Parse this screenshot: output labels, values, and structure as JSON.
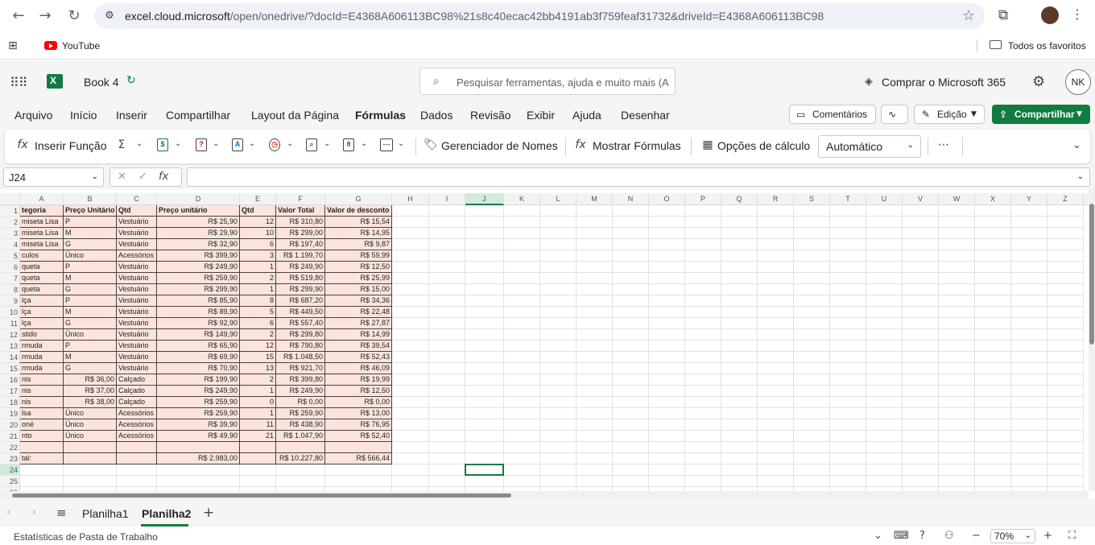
{
  "browser": {
    "url_host": "excel.cloud.microsoft",
    "url_rest": "/open/onedrive/?docId=E4368A606113BC98%21s8c40ecac42bb4191ab3f759feaf31732&driveId=E4368A606113BC98",
    "bookmark_youtube": "YouTube",
    "bookmarks_all": "Todos os favoritos"
  },
  "header": {
    "book_title": "Book 4",
    "search_placeholder": "Pesquisar ferramentas, ajuda e muito mais (A",
    "buy_label": "Comprar o Microsoft 365",
    "avatar_initials": "NK"
  },
  "menu": {
    "tabs": [
      "Arquivo",
      "Início",
      "Inserir",
      "Compartilhar",
      "Layout da Página",
      "Fórmulas",
      "Dados",
      "Revisão",
      "Exibir",
      "Ajuda",
      "Desenhar"
    ],
    "active": "Fórmulas",
    "comments": "Comentários",
    "editing": "Edição",
    "share": "Compartilhar"
  },
  "ribbon": {
    "insert_function": "Inserir Função",
    "name_manager": "Gerenciador de Nomes",
    "show_formulas": "Mostrar Fórmulas",
    "calc_options": "Opções de cálculo",
    "calc_mode": "Automático"
  },
  "formula_bar": {
    "name_box": "J24",
    "fx": "fx"
  },
  "grid": {
    "selected_column": "J",
    "selected_row": "24",
    "columns": [
      "A",
      "B",
      "C",
      "D",
      "E",
      "F",
      "G",
      "H",
      "I",
      "J",
      "K",
      "L",
      "M",
      "N",
      "O",
      "P",
      "Q",
      "R",
      "S",
      "T",
      "U",
      "V",
      "W",
      "X",
      "Y",
      "Z"
    ],
    "row_numbers": [
      "1",
      "2",
      "3",
      "4",
      "5",
      "6",
      "7",
      "8",
      "9",
      "10",
      "11",
      "12",
      "13",
      "14",
      "15",
      "16",
      "17",
      "18",
      "19",
      "20",
      "21",
      "22",
      "23",
      "24",
      "25",
      "26"
    ],
    "table_header": [
      "tegoria",
      "Preço Unitário",
      "Qtd",
      "Preço unitário",
      "Qtd",
      "Valor Total",
      "Valor de desconto"
    ],
    "table_rows": [
      [
        "miseta Lisa",
        "P",
        "Vestuário",
        "R$ 25,90",
        "12",
        "R$ 310,80",
        "R$ 15,54"
      ],
      [
        "miseta Lisa",
        "M",
        "Vestuário",
        "R$ 29,90",
        "10",
        "R$ 299,00",
        "R$ 14,95"
      ],
      [
        "miseta Lisa",
        "G",
        "Vestuário",
        "R$ 32,90",
        "6",
        "R$ 197,40",
        "R$ 9,87"
      ],
      [
        "culos",
        "Único",
        "Acessórios",
        "R$ 399,90",
        "3",
        "R$ 1.199,70",
        "R$ 59,99"
      ],
      [
        "queta",
        "P",
        "Vestuário",
        "R$ 249,90",
        "1",
        "R$ 249,90",
        "R$ 12,50"
      ],
      [
        "queta",
        "M",
        "Vestuário",
        "R$ 259,90",
        "2",
        "R$ 519,80",
        "R$ 25,99"
      ],
      [
        "queta",
        "G",
        "Vestuário",
        "R$ 299,90",
        "1",
        "R$ 299,90",
        "R$ 15,00"
      ],
      [
        "lça",
        "P",
        "Vestuário",
        "R$ 85,90",
        "8",
        "R$ 687,20",
        "R$ 34,36"
      ],
      [
        "lça",
        "M",
        "Vestuário",
        "R$ 89,90",
        "5",
        "R$ 449,50",
        "R$ 22,48"
      ],
      [
        "lça",
        "G",
        "Vestuário",
        "R$ 92,90",
        "6",
        "R$ 557,40",
        "R$ 27,87"
      ],
      [
        "stido",
        "Único",
        "Vestuário",
        "R$ 149,90",
        "2",
        "R$ 299,80",
        "R$ 14,99"
      ],
      [
        "rmuda",
        "P",
        "Vestuário",
        "R$ 65,90",
        "12",
        "R$ 790,80",
        "R$ 39,54"
      ],
      [
        "rmuda",
        "M",
        "Vestuário",
        "R$ 69,90",
        "15",
        "R$ 1.048,50",
        "R$ 52,43"
      ],
      [
        "rmuda",
        "G",
        "Vestuário",
        "R$ 70,90",
        "13",
        "R$ 921,70",
        "R$ 46,09"
      ],
      [
        "nis",
        "R$ 36,00",
        "Calçado",
        "R$ 199,90",
        "2",
        "R$ 399,80",
        "R$ 19,99"
      ],
      [
        "nis",
        "R$ 37,00",
        "Calçado",
        "R$ 249,90",
        "1",
        "R$ 249,90",
        "R$ 12,50"
      ],
      [
        "nis",
        "R$ 38,00",
        "Calçado",
        "R$ 259,90",
        "0",
        "R$ 0,00",
        "R$ 0,00"
      ],
      [
        "lsa",
        "Único",
        "Acessórios",
        "R$ 259,90",
        "1",
        "R$ 259,90",
        "R$ 13,00"
      ],
      [
        "oné",
        "Único",
        "Acessórios",
        "R$ 39,90",
        "11",
        "R$ 438,90",
        "R$ 76,95"
      ],
      [
        "nto",
        "Único",
        "Acessórios",
        "R$ 49,90",
        "21",
        "R$ 1.047,90",
        "R$ 52,40"
      ],
      [
        "",
        "",
        "",
        "",
        "",
        "",
        ""
      ],
      [
        "tal:",
        "",
        "",
        "R$ 2.983,00",
        "",
        "R$ 10.227,80",
        "R$ 566,44"
      ]
    ]
  },
  "sheets": {
    "tabs": [
      "Planilha1",
      "Planilha2"
    ],
    "active": "Planilha2"
  },
  "status": {
    "label": "Estatísticas de Pasta de Trabalho",
    "zoom": "70%"
  },
  "colors": {
    "accent": "#107c41",
    "table_fill": "#fce4dc"
  }
}
